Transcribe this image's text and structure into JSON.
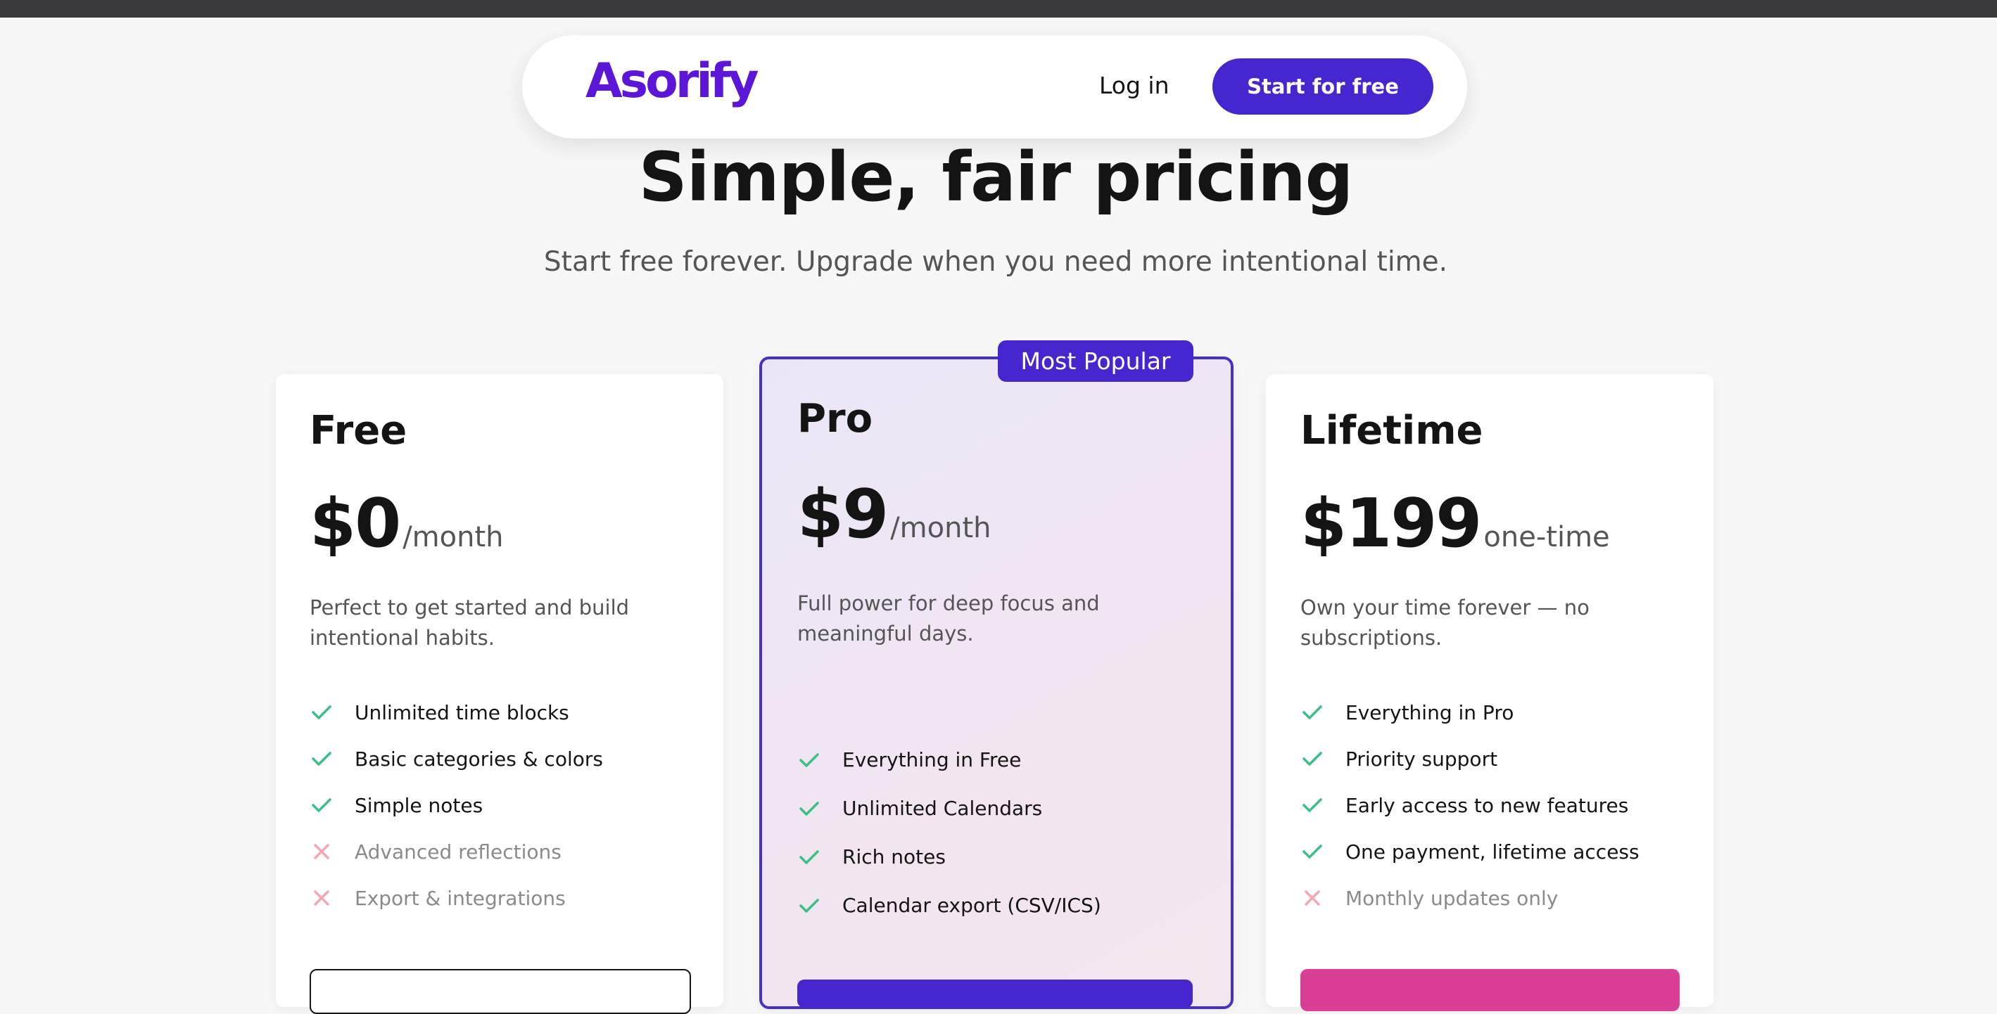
{
  "nav": {
    "logo": "Asorify",
    "login_label": "Log in",
    "cta_label": "Start for free"
  },
  "hero": {
    "title": "Simple, fair pricing",
    "subtitle": "Start free forever. Upgrade when you need more intentional time."
  },
  "plans": [
    {
      "name": "Free",
      "price": "$0",
      "period": "/month",
      "description": "Perfect to get started and build intentional habits.",
      "features": [
        {
          "text": "Unlimited time blocks",
          "included": true
        },
        {
          "text": "Basic categories & colors",
          "included": true
        },
        {
          "text": "Simple notes",
          "included": true
        },
        {
          "text": "Advanced reflections",
          "included": false
        },
        {
          "text": "Export & integrations",
          "included": false
        }
      ]
    },
    {
      "name": "Pro",
      "badge": "Most Popular",
      "price": "$9",
      "period": "/month",
      "description": "Full power for deep focus and meaningful days.",
      "features": [
        {
          "text": "Everything in Free",
          "included": true
        },
        {
          "text": "Unlimited Calendars",
          "included": true
        },
        {
          "text": "Rich notes",
          "included": true
        },
        {
          "text": "Calendar export (CSV/ICS)",
          "included": true
        }
      ]
    },
    {
      "name": "Lifetime",
      "price": "$199",
      "period": "one-time",
      "description": "Own your time forever — no subscriptions.",
      "features": [
        {
          "text": "Everything in Pro",
          "included": true
        },
        {
          "text": "Priority support",
          "included": true
        },
        {
          "text": "Early access to new features",
          "included": true
        },
        {
          "text": "One payment, lifetime access",
          "included": true
        },
        {
          "text": "Monthly updates only",
          "included": false
        }
      ]
    }
  ],
  "colors": {
    "brand": "#5b16d8",
    "primary": "#4526cf",
    "check": "#3bbf86",
    "cross": "#f2a7b3",
    "lifetime_button": "#d93f97"
  },
  "icons": {
    "included": "check-icon",
    "excluded": "x-icon"
  }
}
